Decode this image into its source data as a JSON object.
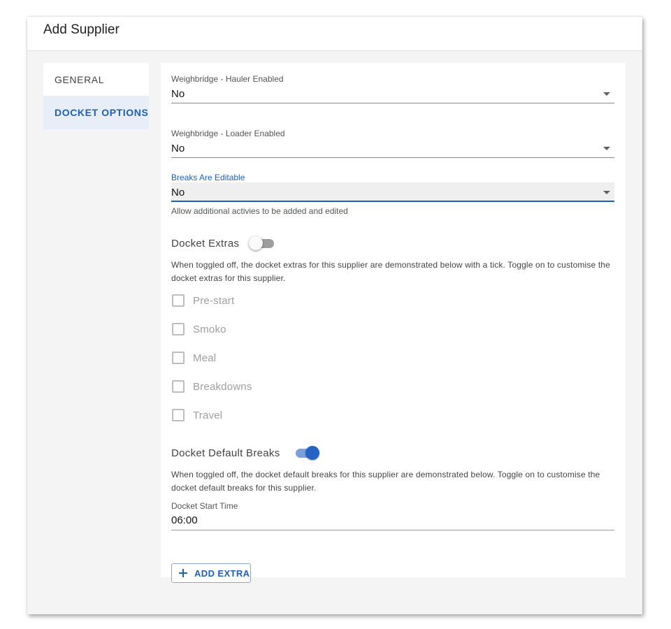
{
  "dialog": {
    "title": "Add Supplier"
  },
  "nav": {
    "items": [
      {
        "label": "GENERAL",
        "active": false
      },
      {
        "label": "DOCKET OPTIONS",
        "active": true
      }
    ]
  },
  "fields": {
    "hauler": {
      "label": "Weighbridge - Hauler Enabled",
      "value": "No"
    },
    "loader": {
      "label": "Weighbridge - Loader Enabled",
      "value": "No"
    },
    "breaks": {
      "label": "Breaks Are Editable",
      "value": "No",
      "hint": "Allow additional activies to be added and edited"
    }
  },
  "docket_extras": {
    "label": "Docket Extras",
    "enabled": false,
    "description": "When toggled off, the docket extras for this supplier are demonstrated below with a tick. Toggle on to customise the docket extras for this supplier.",
    "items": [
      {
        "label": "Pre-start",
        "checked": false
      },
      {
        "label": "Smoko",
        "checked": false
      },
      {
        "label": "Meal",
        "checked": false
      },
      {
        "label": "Breakdowns",
        "checked": false
      },
      {
        "label": "Travel",
        "checked": false
      }
    ]
  },
  "docket_default_breaks": {
    "label": "Docket Default Breaks",
    "enabled": true,
    "description": "When toggled off, the docket default breaks for this supplier are demonstrated below. Toggle on to customise the docket default breaks for this supplier.",
    "start_time_label": "Docket Start Time",
    "start_time_value": "06:00"
  },
  "actions": {
    "add_extra_label": "ADD EXTRA"
  },
  "colors": {
    "accent": "#1e5fb8",
    "panel_bg": "#f4f4f4"
  }
}
